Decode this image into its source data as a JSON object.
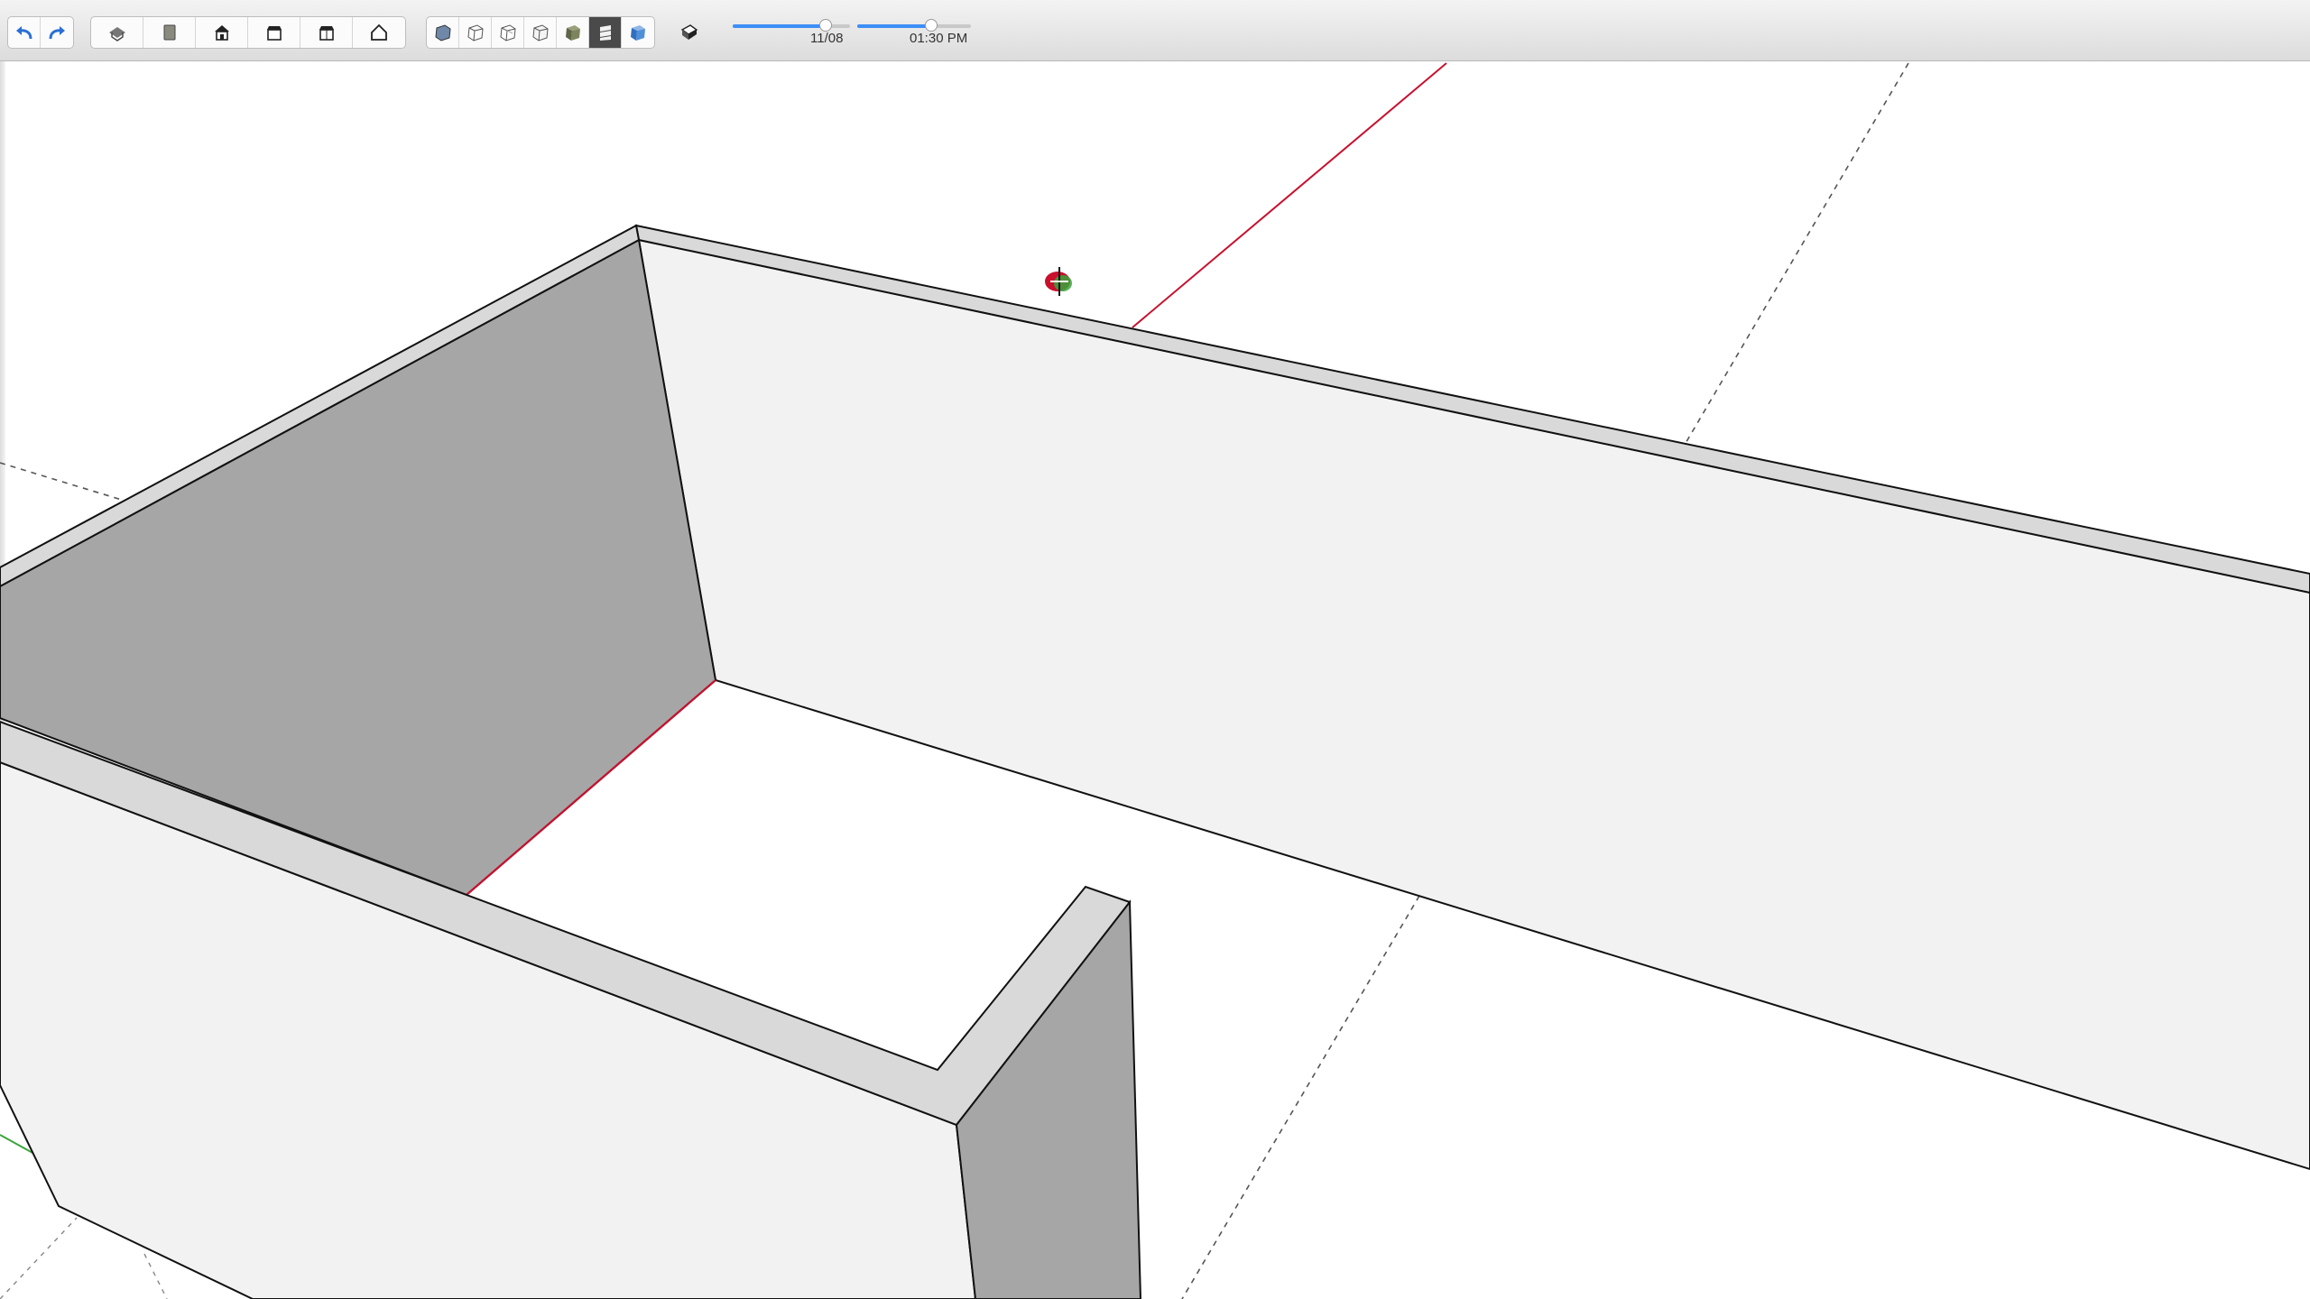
{
  "toolbar": {
    "history": [
      {
        "icon": "undo-icon"
      },
      {
        "icon": "redo-icon"
      }
    ],
    "views": [
      {
        "icon": "iso-view-icon"
      },
      {
        "icon": "top-view-icon"
      },
      {
        "icon": "front-view-icon"
      },
      {
        "icon": "right-view-icon"
      },
      {
        "icon": "back-view-icon"
      },
      {
        "icon": "left-view-icon"
      }
    ],
    "styles": [
      {
        "icon": "xray-style-icon"
      },
      {
        "icon": "wireframe-style-icon"
      },
      {
        "icon": "hidden-line-style-icon"
      },
      {
        "icon": "shaded-style-icon"
      },
      {
        "icon": "shaded-textures-style-icon"
      },
      {
        "icon": "monochrome-style-icon",
        "active": true
      },
      {
        "icon": "colored-style-icon"
      }
    ],
    "shadows": {
      "icon": "shadows-toggle-icon"
    },
    "date_slider": {
      "label": "11/08",
      "value": 0.79
    },
    "time_slider": {
      "label": "01:30 PM",
      "value": 0.65
    }
  },
  "canvas": {
    "background": "#ffffff",
    "wall_top_color": "#d9d9d9",
    "wall_face_light": "#f2f2f2",
    "wall_face_dark": "#a6a6a6",
    "red_axis_color": "#c8102e",
    "green_axis_color": "#3aa53a",
    "cursor": {
      "icon": "orbit-cursor-icon"
    }
  }
}
